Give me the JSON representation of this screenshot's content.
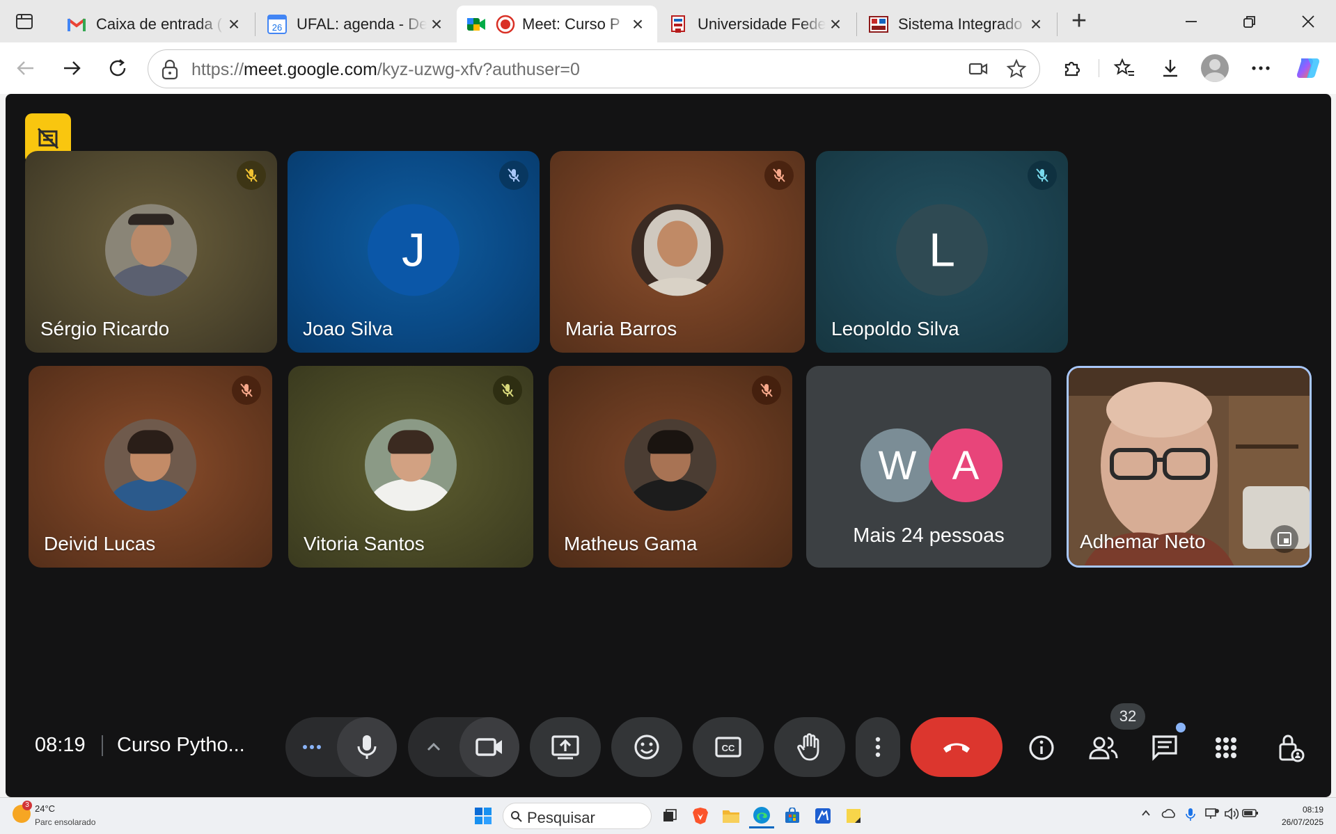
{
  "browser": {
    "tabs": [
      {
        "title": "Caixa de entrada (",
        "favicon": "gmail-icon"
      },
      {
        "title": "UFAL: agenda - De",
        "favicon": "calendar-icon",
        "favicon_text": "26"
      },
      {
        "title": "Meet: Curso P",
        "favicon": "meet-icon",
        "active": true
      },
      {
        "title": "Universidade Fede",
        "favicon": "ufal-icon"
      },
      {
        "title": "Sistema Integrado",
        "favicon": "sigaa-icon"
      }
    ],
    "url_prefix": "https://",
    "url_host": "meet.google.com",
    "url_path": "/kyz-uzwg-xfv?authuser=0"
  },
  "meeting": {
    "participants_row1": [
      {
        "name": "Sérgio Ricardo",
        "avatar": "photo",
        "muted": true
      },
      {
        "name": "Joao Silva",
        "avatar_letter": "J",
        "muted": true
      },
      {
        "name": "Maria Barros",
        "avatar": "photo",
        "muted": true
      },
      {
        "name": "Leopoldo Silva",
        "avatar_letter": "L",
        "muted": true
      }
    ],
    "participants_row2": [
      {
        "name": "Deivid Lucas",
        "avatar": "photo",
        "muted": true
      },
      {
        "name": "Vitoria Santos",
        "avatar": "photo",
        "muted": true
      },
      {
        "name": "Matheus Gama",
        "avatar": "photo",
        "muted": true
      }
    ],
    "more": {
      "letters": [
        "W",
        "A"
      ],
      "label": "Mais 24 pessoas"
    },
    "self": {
      "name": "Adhemar Neto"
    },
    "time": "08:19",
    "title": "Curso Pytho...",
    "people_count": "32"
  },
  "taskbar": {
    "weather_temp": "24°C",
    "weather_cond": "Parc ensolarado",
    "weather_badge": "3",
    "search_label": "Pesquisar",
    "clock_time": "08:19",
    "clock_date": "26/07/2025"
  },
  "colors": {
    "end_call": "#dc362e",
    "badge_yellow": "#f9c60f",
    "selfie_border": "#a8c7fa"
  }
}
